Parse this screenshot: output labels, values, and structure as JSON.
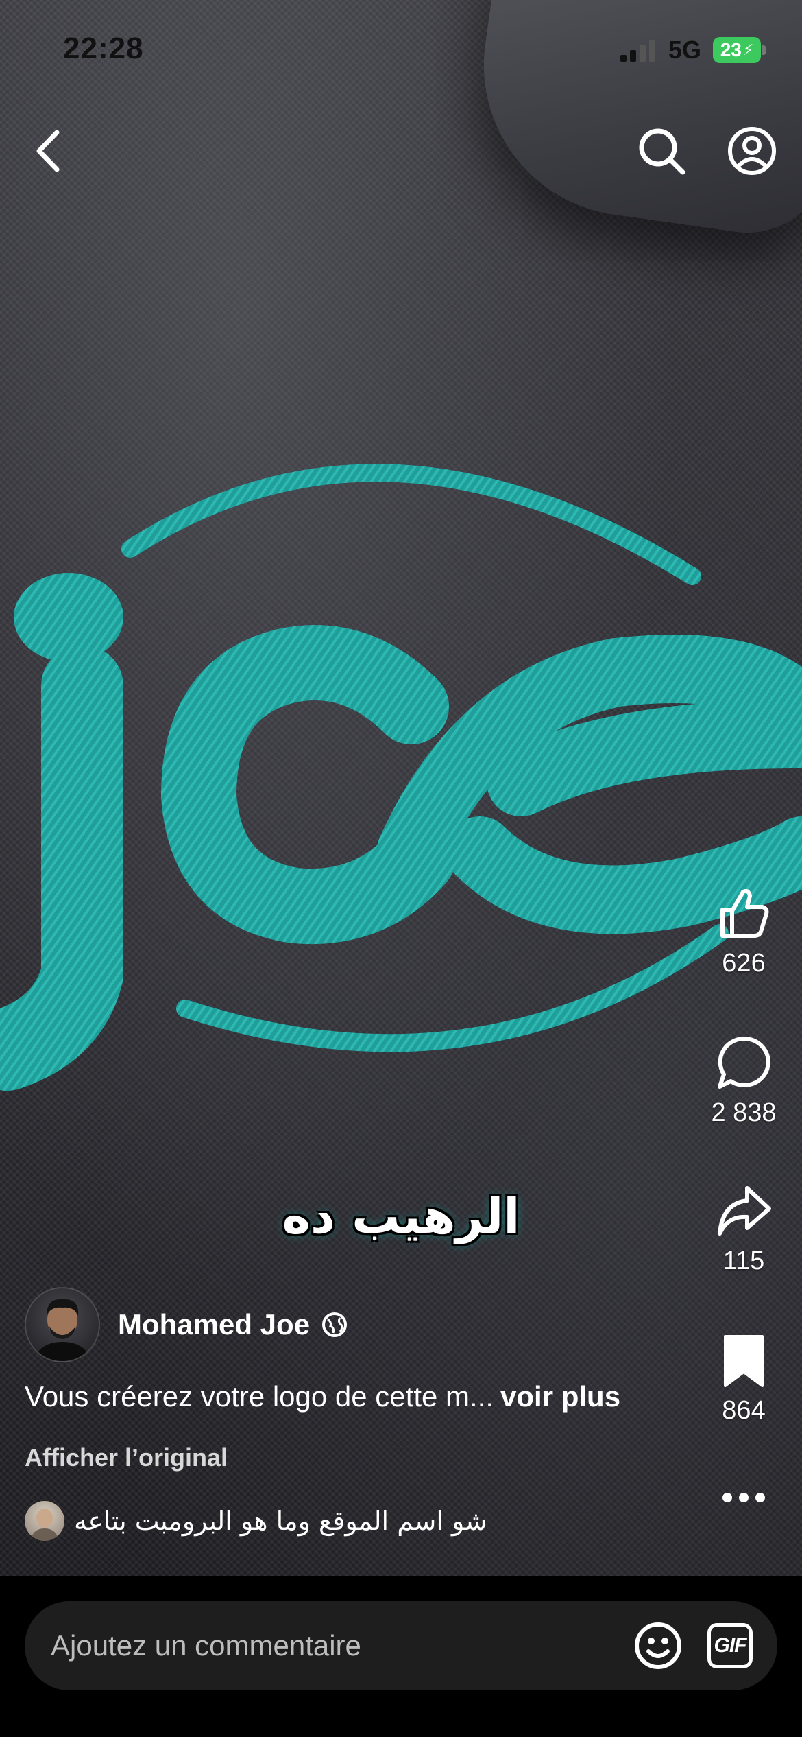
{
  "status_bar": {
    "time": "22:28",
    "network": "5G",
    "battery": "23"
  },
  "video": {
    "logo_text": "joe",
    "caption": "الرهيب ده",
    "brand_color": "#1f9e9a"
  },
  "actions": {
    "likes": "626",
    "comments": "2 838",
    "shares": "115",
    "saves": "864"
  },
  "post": {
    "author": "Mohamed Joe",
    "description": "Vous créerez votre logo de cette m...",
    "more_label": "voir plus",
    "translate_label": "Afficher l’original",
    "top_comment": "شو اسم الموقع وما هو البرومبت بتاعه"
  },
  "comment_bar": {
    "placeholder": "Ajoutez un commentaire",
    "gif_label": "GIF"
  }
}
